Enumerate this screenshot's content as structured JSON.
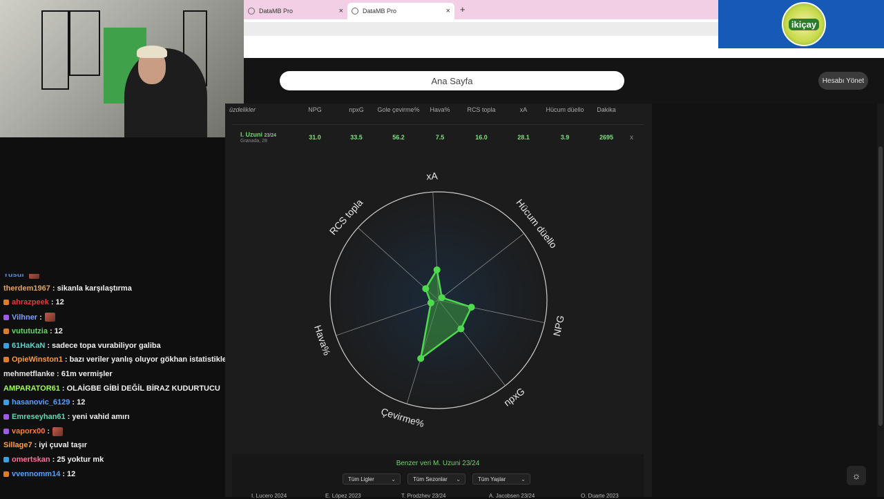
{
  "browser": {
    "tabs": [
      {
        "label": "DataMB Pro",
        "close": "×"
      },
      {
        "label": "DataMB Pro",
        "close": "×"
      }
    ],
    "new_tab": "+"
  },
  "brand": {
    "logo_text": "ikiçay"
  },
  "app": {
    "search_label": "Ana Sayfa",
    "manage_account": "Hesabı Yönet"
  },
  "table": {
    "headers": [
      "üzdelikler",
      "NPG",
      "npxG",
      "Gole çevirme%",
      "Hava%",
      "RCS topla",
      "xA",
      "Hücum düello",
      "Dakika"
    ],
    "player": {
      "name": "I. Uzuni",
      "season": "23/24",
      "club_age": "Granada, 28"
    },
    "values": [
      "31.0",
      "33.5",
      "56.2",
      "7.5",
      "16.0",
      "28.1",
      "3.9",
      "2695"
    ],
    "remove": "x"
  },
  "chart_data": {
    "type": "radar",
    "axes": [
      "xA",
      "Hücum düello",
      "NPG",
      "npxG",
      "Çevirme%",
      "Hava%",
      "RCS topla"
    ],
    "series": [
      {
        "values": [
          28.1,
          3.9,
          31.0,
          33.5,
          56.2,
          7.5,
          16.0
        ]
      }
    ],
    "rlim": [
      0,
      100
    ],
    "colors": {
      "line": "#4fd94f",
      "fill": "#3c9a3c",
      "grid": "#cfcfcf"
    }
  },
  "similar": {
    "title": "Benzer veri M. Uzuni 23/24",
    "filters": [
      "Tüm Ligler",
      "Tüm Sezonlar",
      "Tüm Yaşlar"
    ],
    "bottom_items": [
      "I. Lucero 2024",
      "E. López 2023",
      "T. Prodzhev 23/24",
      "A. Jacobsen 23/24",
      "O. Duarte 2023"
    ]
  },
  "chat": [
    {
      "user": "Yusuf",
      "msg": "",
      "emote": true,
      "color": "#5b8dd6",
      "badge": ""
    },
    {
      "user": "therdem1967",
      "msg": ": sikanla karşılaştırma",
      "color": "#e8a25a",
      "badge": ""
    },
    {
      "user": "ahrazpeek",
      "msg": ": 12",
      "color": "#e23b3b",
      "badge": "#e07b2a"
    },
    {
      "user": "Vilhner",
      "msg": ":",
      "emote": true,
      "color": "#7aa2ff",
      "badge": "#9b5be6"
    },
    {
      "user": "vutututzia",
      "msg": ": 12",
      "color": "#5fd95f",
      "badge": "#e07b2a"
    },
    {
      "user": "61HaKaN",
      "msg": ": sadece topa vurabiliyor galiba",
      "color": "#5ad6c8",
      "badge": "#3aa0e0"
    },
    {
      "user": "OpieWinston1",
      "msg": ": bazı veriler yanlış oluyor gökhan istatistiklerine bakarmısın",
      "color": "#ff9a3c",
      "badge": "#e07b2a"
    },
    {
      "user": "mehmetflanke",
      "msg": ": 61m vermişler",
      "color": "#e6e6e6",
      "badge": ""
    },
    {
      "user": "AMPARATOR61",
      "msg": ": OLAİGBE GİBİ DEĞİL BİRAZ KUDURTUCU",
      "color": "#9bff4f",
      "badge": ""
    },
    {
      "user": "hasanovic_6129",
      "msg": ": 12",
      "color": "#4fa3ff",
      "badge": "#3aa0e0"
    },
    {
      "user": "Emreseyhan61",
      "msg": ": yeni vahid amırı",
      "color": "#5fd9b4",
      "badge": "#9b5be6"
    },
    {
      "user": "vaporx00",
      "msg": ":",
      "emote": true,
      "color": "#ff7a3c",
      "badge": "#9b5be6"
    },
    {
      "user": "Sillage7",
      "msg": ": iyi çuval taşır",
      "color": "#ff9f43",
      "badge": ""
    },
    {
      "user": "omertskan",
      "msg": ": 25 yoktur mk",
      "color": "#ff6f9a",
      "badge": "#3aa0e0"
    },
    {
      "user": "vvennomm14",
      "msg": ": 12",
      "color": "#4fa3ff",
      "badge": "#e07b2a"
    }
  ]
}
